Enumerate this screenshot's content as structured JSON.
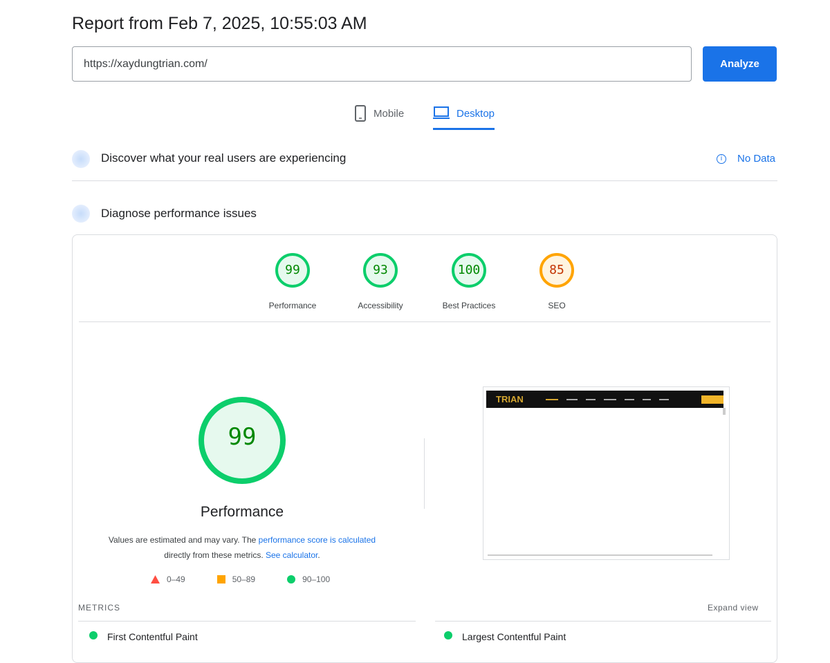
{
  "header": {
    "title": "Report from Feb 7, 2025, 10:55:03 AM"
  },
  "search": {
    "url": "https://xaydungtrian.com/",
    "analyze_label": "Analyze"
  },
  "tabs": [
    {
      "label": "Mobile",
      "icon": "phone-icon"
    },
    {
      "label": "Desktop",
      "icon": "laptop-icon",
      "active": true
    }
  ],
  "crux": {
    "title": "Discover what your real users are experiencing",
    "status": "No Data"
  },
  "diagnose": {
    "title": "Diagnose performance issues"
  },
  "scores": [
    {
      "label": "Performance",
      "value": "99",
      "color": "#0cce6b"
    },
    {
      "label": "Accessibility",
      "value": "93",
      "color": "#0cce6b"
    },
    {
      "label": "Best Practices",
      "value": "100",
      "color": "#0cce6b"
    },
    {
      "label": "SEO",
      "value": "85",
      "color": "#ffa400"
    }
  ],
  "main_gauge": {
    "value": "99",
    "label": "Performance",
    "color": "#0cce6b"
  },
  "note": {
    "text1": "Values are estimated and may vary. The ",
    "link1": "performance score is calculated",
    "text2": "directly from these metrics. ",
    "link2": "See calculator",
    "text3": "."
  },
  "legend": [
    {
      "range": "0–49",
      "color": "#ff4e42"
    },
    {
      "range": "50–89",
      "color": "#ffa400"
    },
    {
      "range": "90–100",
      "color": "#0cce6b"
    }
  ],
  "screenshot": {
    "logo": "TRIAN"
  },
  "metrics": {
    "heading": "METRICS",
    "expand": "Expand view",
    "items": [
      {
        "label": "First Contentful Paint",
        "color": "#0cce6b"
      },
      {
        "label": "Largest Contentful Paint",
        "color": "#0cce6b"
      }
    ]
  }
}
